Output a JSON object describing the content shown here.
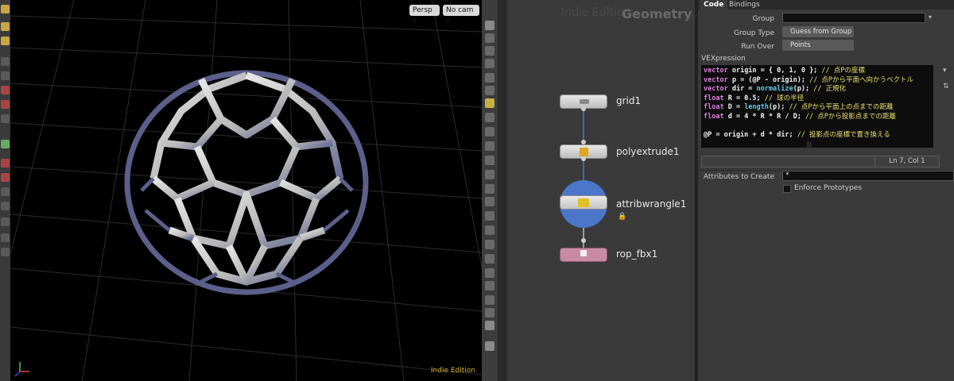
{
  "viewport": {
    "persp_label": "Persp",
    "cam_label": "No cam",
    "edition_label": "Indie Edition",
    "edition_color": "#d6b43a"
  },
  "network": {
    "watermark_edition": "Indie Edition",
    "watermark_context": "Geometry",
    "nodes": [
      {
        "name": "grid1"
      },
      {
        "name": "polyextrude1"
      },
      {
        "name": "attribwrangle1"
      },
      {
        "name": "rop_fbx1"
      }
    ],
    "rop_color": "#c98aa4",
    "wrangle_ring_color": "#4a77c9"
  },
  "params": {
    "tabs": [
      "Code",
      "Bindings"
    ],
    "group_label": "Group",
    "group_value": "",
    "group_type_label": "Group Type",
    "group_type_value": "Guess from Group",
    "run_over_label": "Run Over",
    "run_over_value": "Points",
    "vex_label": "VEXpression",
    "code": {
      "l1a": "vector",
      "l1b": " origin = { 0, 1, 0 }; ",
      "l1c": "// 点Pの座標",
      "l2a": "vector",
      "l2b": " p = (@P - origin); ",
      "l2c": "// 点Pから平面へ向かうベクトル",
      "l3a": "vector",
      "l3b": " dir = ",
      "l3f": "normalize",
      "l3d": "(p); ",
      "l3c": "// 正規化",
      "l4a": "float",
      "l4b": " R = 0.5; ",
      "l4c": "// 球の半径",
      "l5a": "float",
      "l5b": " D = ",
      "l5f": "length",
      "l5d": "(p); ",
      "l5c": "// 点Pから平面上の点までの距離",
      "l6a": "float",
      "l6b": " d = 4 * R * R / D; ",
      "l6c": "// 点Pから投影点までの距離",
      "l7b": "@P = origin + d * dir; ",
      "l7c": "// 投影点の座標で置き換える"
    },
    "status": "Ln 7, Col 1",
    "attributes_label": "Attributes to Create",
    "attributes_value": "*",
    "enforce_label": "Enforce Prototypes"
  }
}
